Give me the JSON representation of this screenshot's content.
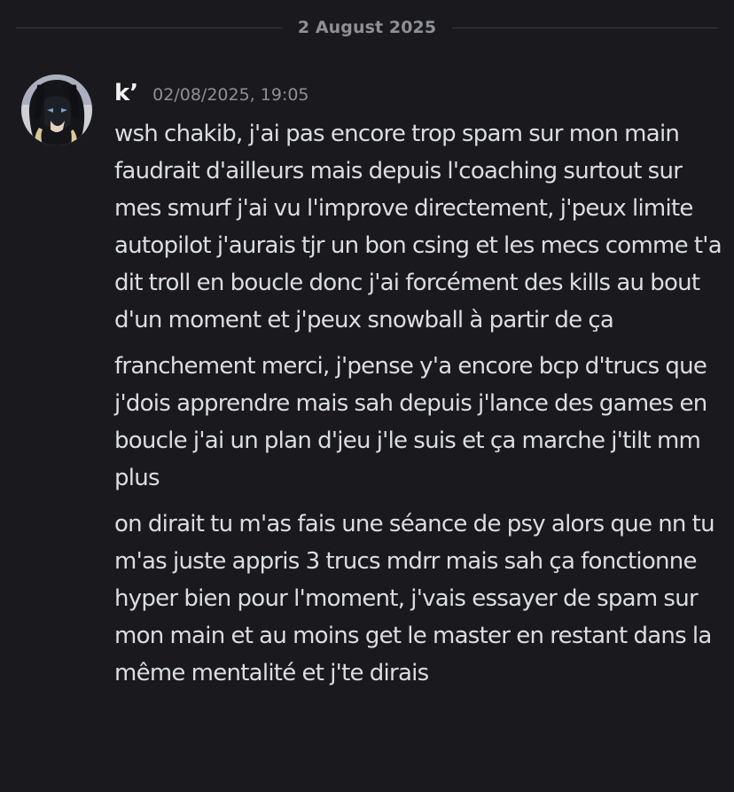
{
  "date_divider": "2 August 2025",
  "message": {
    "username": "k’",
    "timestamp": "02/08/2025, 19:05",
    "avatar_icon": "anime-character-avatar",
    "paragraphs": [
      "wsh chakib, j'ai pas encore trop spam sur mon main faudrait d'ailleurs mais depuis l'coaching surtout sur mes smurf j'ai vu l'improve directement, j'peux limite autopilot j'aurais tjr un bon csing et les mecs comme t'a dit troll en boucle donc j'ai forcément des kills au bout d'un moment et j'peux snowball à partir de ça",
      "franchement merci, j'pense y'a encore bcp d'trucs que j'dois apprendre mais sah depuis j'lance des games en boucle j'ai un plan d'jeu j'le suis et ça marche j'tilt mm plus",
      "on dirait tu m'as fais une séance de psy alors que nn tu m'as juste appris 3 trucs mdrr mais sah ça fonctionne hyper bien pour l'moment, j'vais essayer de spam sur mon main et au moins get le master en restant dans la même mentalité et j'te dirais"
    ]
  },
  "colors": {
    "background": "#1a1a1e",
    "text": "#dbdee1",
    "muted": "#8e9098",
    "username": "#f2f3f5"
  }
}
